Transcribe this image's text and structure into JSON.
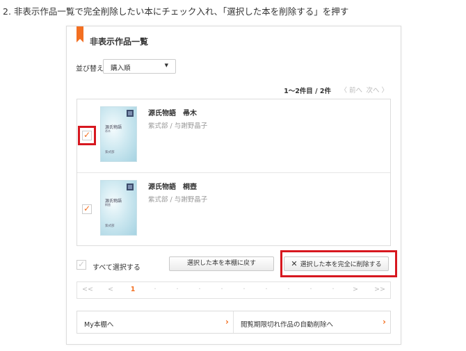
{
  "instruction": "2. 非表示作品一覧で完全削除したい本にチェック入れ、「選択した本を削除する」を押す",
  "panel": {
    "title": "非表示作品一覧"
  },
  "sort": {
    "label": "並び替え",
    "selected": "購入順"
  },
  "paging": {
    "info": "1〜2件目 / 2件",
    "prev": "〈 前へ",
    "next": "次へ 〉"
  },
  "books": [
    {
      "title": "源氏物語　帚木",
      "author": "紫式部 / 与謝野晶子",
      "checked": true,
      "cover": {
        "title": "源氏物語",
        "subtitle": "帚木",
        "publisher": "紫式部"
      }
    },
    {
      "title": "源氏物語　桐壺",
      "author": "紫式部 / 与謝野晶子",
      "checked": true,
      "cover": {
        "title": "源氏物語",
        "subtitle": "桐壺",
        "publisher": "紫式部"
      }
    }
  ],
  "select_all": {
    "label": "すべて選択する",
    "checked": false
  },
  "buttons": {
    "restore": "選択した本を本棚に戻す",
    "delete": "選択した本を完全に削除する"
  },
  "pager": {
    "first": "<<",
    "prev": "<",
    "current": "1",
    "next": ">",
    "last": ">>"
  },
  "footer": {
    "my_shelf": "My本棚へ",
    "auto_delete": "閲覧期限切れ作品の自動削除へ"
  },
  "colors": {
    "accent": "#f36f21",
    "highlight": "#d7171f"
  }
}
